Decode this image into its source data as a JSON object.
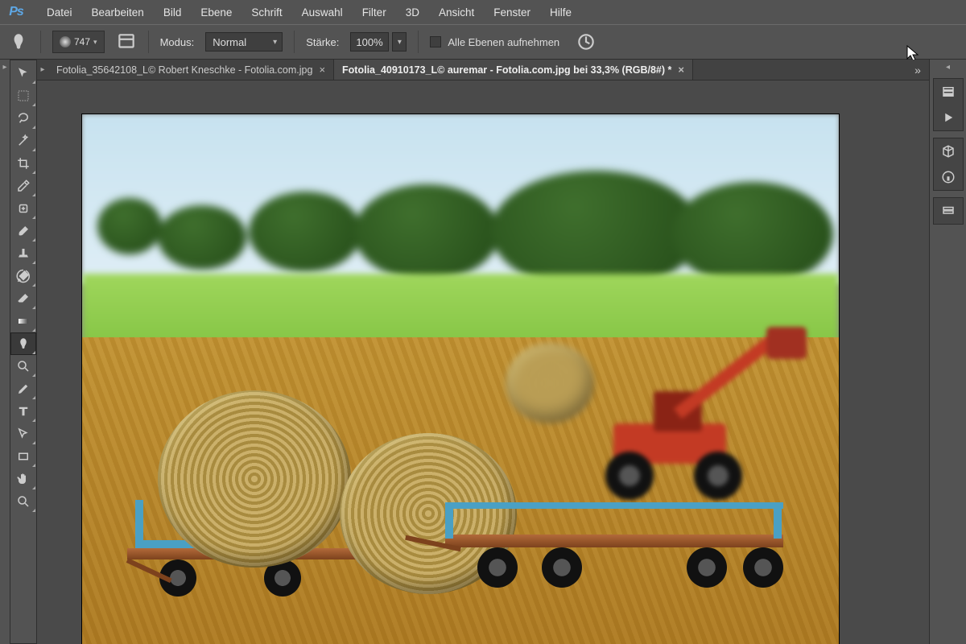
{
  "app": {
    "logo_text": "Ps"
  },
  "menu": [
    "Datei",
    "Bearbeiten",
    "Bild",
    "Ebene",
    "Schrift",
    "Auswahl",
    "Filter",
    "3D",
    "Ansicht",
    "Fenster",
    "Hilfe"
  ],
  "options": {
    "tool_icon": "blur-tool",
    "brush_size": "747",
    "mode_label": "Modus:",
    "mode_value": "Normal",
    "strength_label": "Stärke:",
    "strength_value": "100%",
    "sample_all_label": "Alle Ebenen aufnehmen"
  },
  "tabs": [
    {
      "label": "Fotolia_35642108_L© Robert Kneschke - Fotolia.com.jpg",
      "active": false
    },
    {
      "label": "Fotolia_40910173_L© auremar - Fotolia.com.jpg bei 33,3% (RGB/8#) *",
      "active": true
    }
  ],
  "toolbar": [
    "move",
    "marquee",
    "lasso",
    "magic-wand",
    "crop",
    "eyedropper",
    "healing-brush",
    "brush",
    "clone-stamp",
    "history-brush",
    "eraser",
    "gradient",
    "blur",
    "dodge",
    "pen",
    "type",
    "path-select",
    "rectangle",
    "hand",
    "zoom"
  ],
  "active_tool": "blur",
  "right_dock": {
    "group1": [
      "history",
      "play"
    ],
    "group2": [
      "cube3d",
      "info"
    ],
    "group3": [
      "layers"
    ]
  },
  "canvas_image": {
    "description": "Farm harvest scene: round hay bales on flatbed trailers in a stubble field, red telehandler loader in background, trees and green field behind, shallow depth of field (background blurred)."
  }
}
